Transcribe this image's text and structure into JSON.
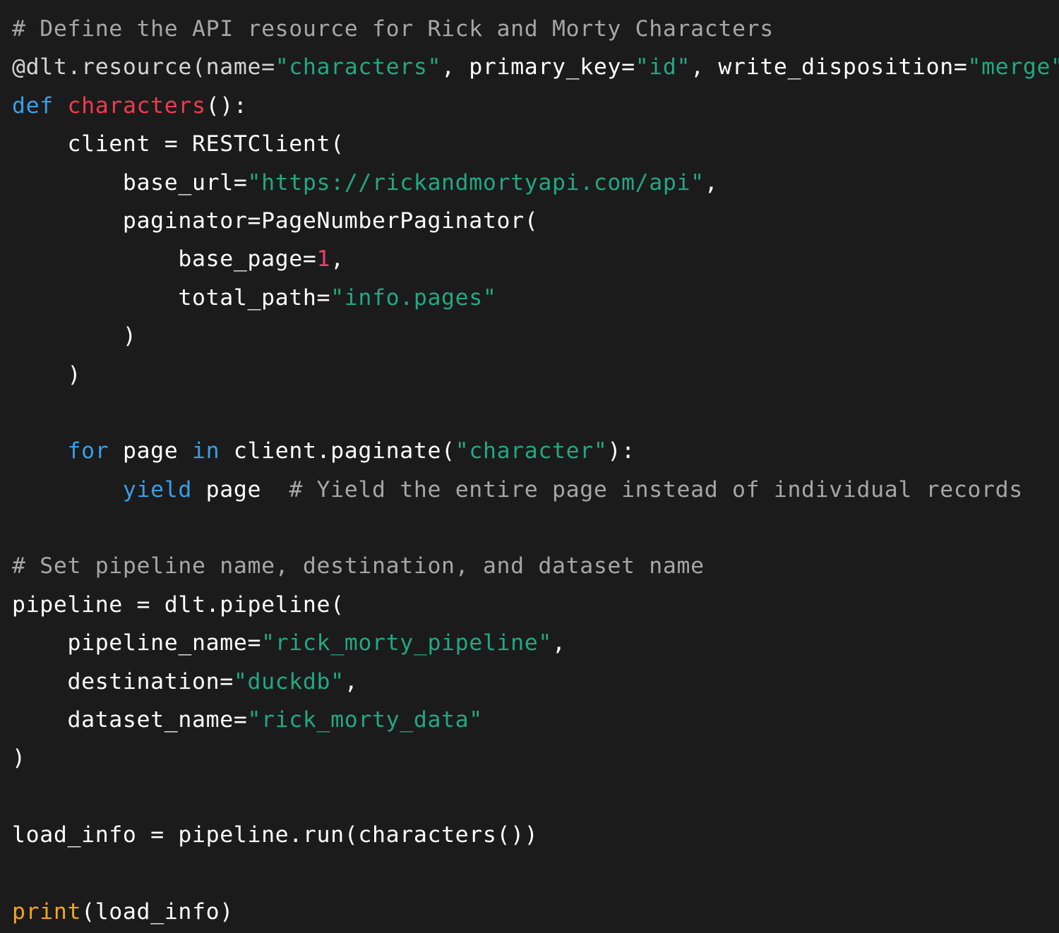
{
  "colors": {
    "background": "#1b1b1b",
    "comment": "#a6a6a6",
    "keyword": "#3b9ee5",
    "function_name": "#ef3b4d",
    "string": "#22a882",
    "number": "#e6406c",
    "builtin": "#f2a41f",
    "plain": "#ffffff"
  },
  "code": {
    "language": "python",
    "lines": [
      [
        {
          "t": "# Define the API resource for Rick and Morty Characters",
          "k": "comment"
        }
      ],
      [
        {
          "t": "@dlt.resource(name=",
          "k": "deco"
        },
        {
          "t": "\"characters\"",
          "k": "string"
        },
        {
          "t": ", primary_key=",
          "k": "plain"
        },
        {
          "t": "\"id\"",
          "k": "string"
        },
        {
          "t": ", write_disposition=",
          "k": "plain"
        },
        {
          "t": "\"merge\"",
          "k": "string"
        },
        {
          "t": ")",
          "k": "plain"
        }
      ],
      [
        {
          "t": "def",
          "k": "keyword"
        },
        {
          "t": " ",
          "k": "plain"
        },
        {
          "t": "characters",
          "k": "fname"
        },
        {
          "t": "():",
          "k": "plain"
        }
      ],
      [
        {
          "t": "    client = RESTClient(",
          "k": "plain"
        }
      ],
      [
        {
          "t": "        base_url=",
          "k": "plain"
        },
        {
          "t": "\"https://rickandmortyapi.com/api\"",
          "k": "string"
        },
        {
          "t": ",",
          "k": "plain"
        }
      ],
      [
        {
          "t": "        paginator=PageNumberPaginator(",
          "k": "plain"
        }
      ],
      [
        {
          "t": "            base_page=",
          "k": "plain"
        },
        {
          "t": "1",
          "k": "number"
        },
        {
          "t": ",",
          "k": "plain"
        }
      ],
      [
        {
          "t": "            total_path=",
          "k": "plain"
        },
        {
          "t": "\"info.pages\"",
          "k": "string"
        }
      ],
      [
        {
          "t": "        )",
          "k": "plain"
        }
      ],
      [
        {
          "t": "    )",
          "k": "plain"
        }
      ],
      [],
      [
        {
          "t": "    ",
          "k": "plain"
        },
        {
          "t": "for",
          "k": "keyword"
        },
        {
          "t": " page ",
          "k": "plain"
        },
        {
          "t": "in",
          "k": "keyword"
        },
        {
          "t": " client.paginate(",
          "k": "plain"
        },
        {
          "t": "\"character\"",
          "k": "string"
        },
        {
          "t": "):",
          "k": "plain"
        }
      ],
      [
        {
          "t": "        ",
          "k": "plain"
        },
        {
          "t": "yield",
          "k": "keyword"
        },
        {
          "t": " page  ",
          "k": "plain"
        },
        {
          "t": "# Yield the entire page instead of individual records",
          "k": "comment"
        }
      ],
      [],
      [
        {
          "t": "# Set pipeline name, destination, and dataset name",
          "k": "comment"
        }
      ],
      [
        {
          "t": "pipeline = dlt.pipeline(",
          "k": "plain"
        }
      ],
      [
        {
          "t": "    pipeline_name=",
          "k": "plain"
        },
        {
          "t": "\"rick_morty_pipeline\"",
          "k": "string"
        },
        {
          "t": ",",
          "k": "plain"
        }
      ],
      [
        {
          "t": "    destination=",
          "k": "plain"
        },
        {
          "t": "\"duckdb\"",
          "k": "string"
        },
        {
          "t": ",",
          "k": "plain"
        }
      ],
      [
        {
          "t": "    dataset_name=",
          "k": "plain"
        },
        {
          "t": "\"rick_morty_data\"",
          "k": "string"
        }
      ],
      [
        {
          "t": ")",
          "k": "plain"
        }
      ],
      [],
      [
        {
          "t": "load_info = pipeline.run(characters())",
          "k": "plain"
        }
      ],
      [],
      [
        {
          "t": "print",
          "k": "builtin"
        },
        {
          "t": "(load_info)",
          "k": "plain"
        }
      ]
    ]
  }
}
